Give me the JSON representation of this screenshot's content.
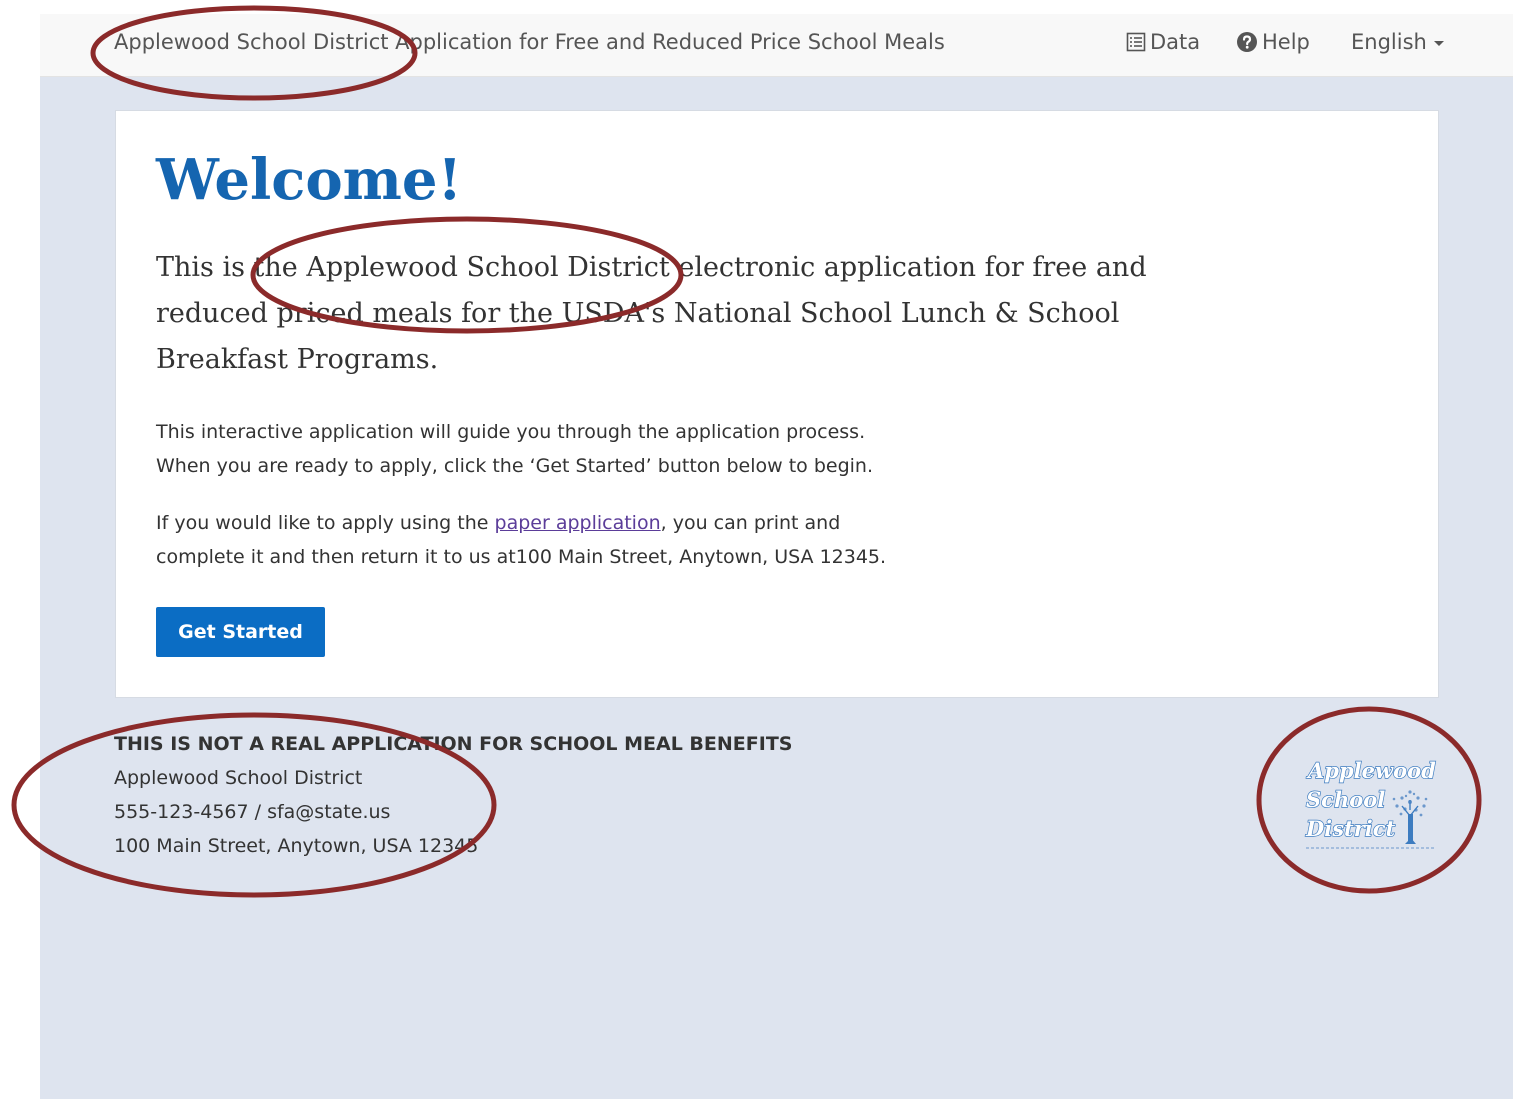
{
  "navbar": {
    "brand": "Applewood School District Application for Free and Reduced Price School Meals",
    "data_label": "Data",
    "help_label": "Help",
    "language_label": "English"
  },
  "main": {
    "heading": "Welcome!",
    "lead": "This is the Applewood School District electronic application for free and reduced priced meals for the USDA's National School Lunch & School Breakfast Programs.",
    "paragraph1": "This interactive application will guide you through the application process. When you are ready to apply, click the ‘Get Started’ button below to begin.",
    "paragraph2_before": "If you would like to apply using the ",
    "paragraph2_link": "paper application",
    "paragraph2_after": ", you can print and complete it and then return it to us at100 Main Street, Anytown, USA 12345.",
    "get_started_label": "Get Started"
  },
  "footer": {
    "disclaimer": "THIS IS NOT A REAL APPLICATION FOR SCHOOL MEAL BENEFITS",
    "district": "Applewood School District",
    "contact": "555-123-4567 / sfa@state.us",
    "address": "100 Main Street, Anytown, USA 12345"
  },
  "logo": {
    "line1": "Applewood",
    "line2": "School",
    "line3": "District"
  },
  "colors": {
    "accent": "#1565b0",
    "button": "#0b6dc4",
    "background": "#dee4ef",
    "annotation": "#8b2a2a"
  }
}
